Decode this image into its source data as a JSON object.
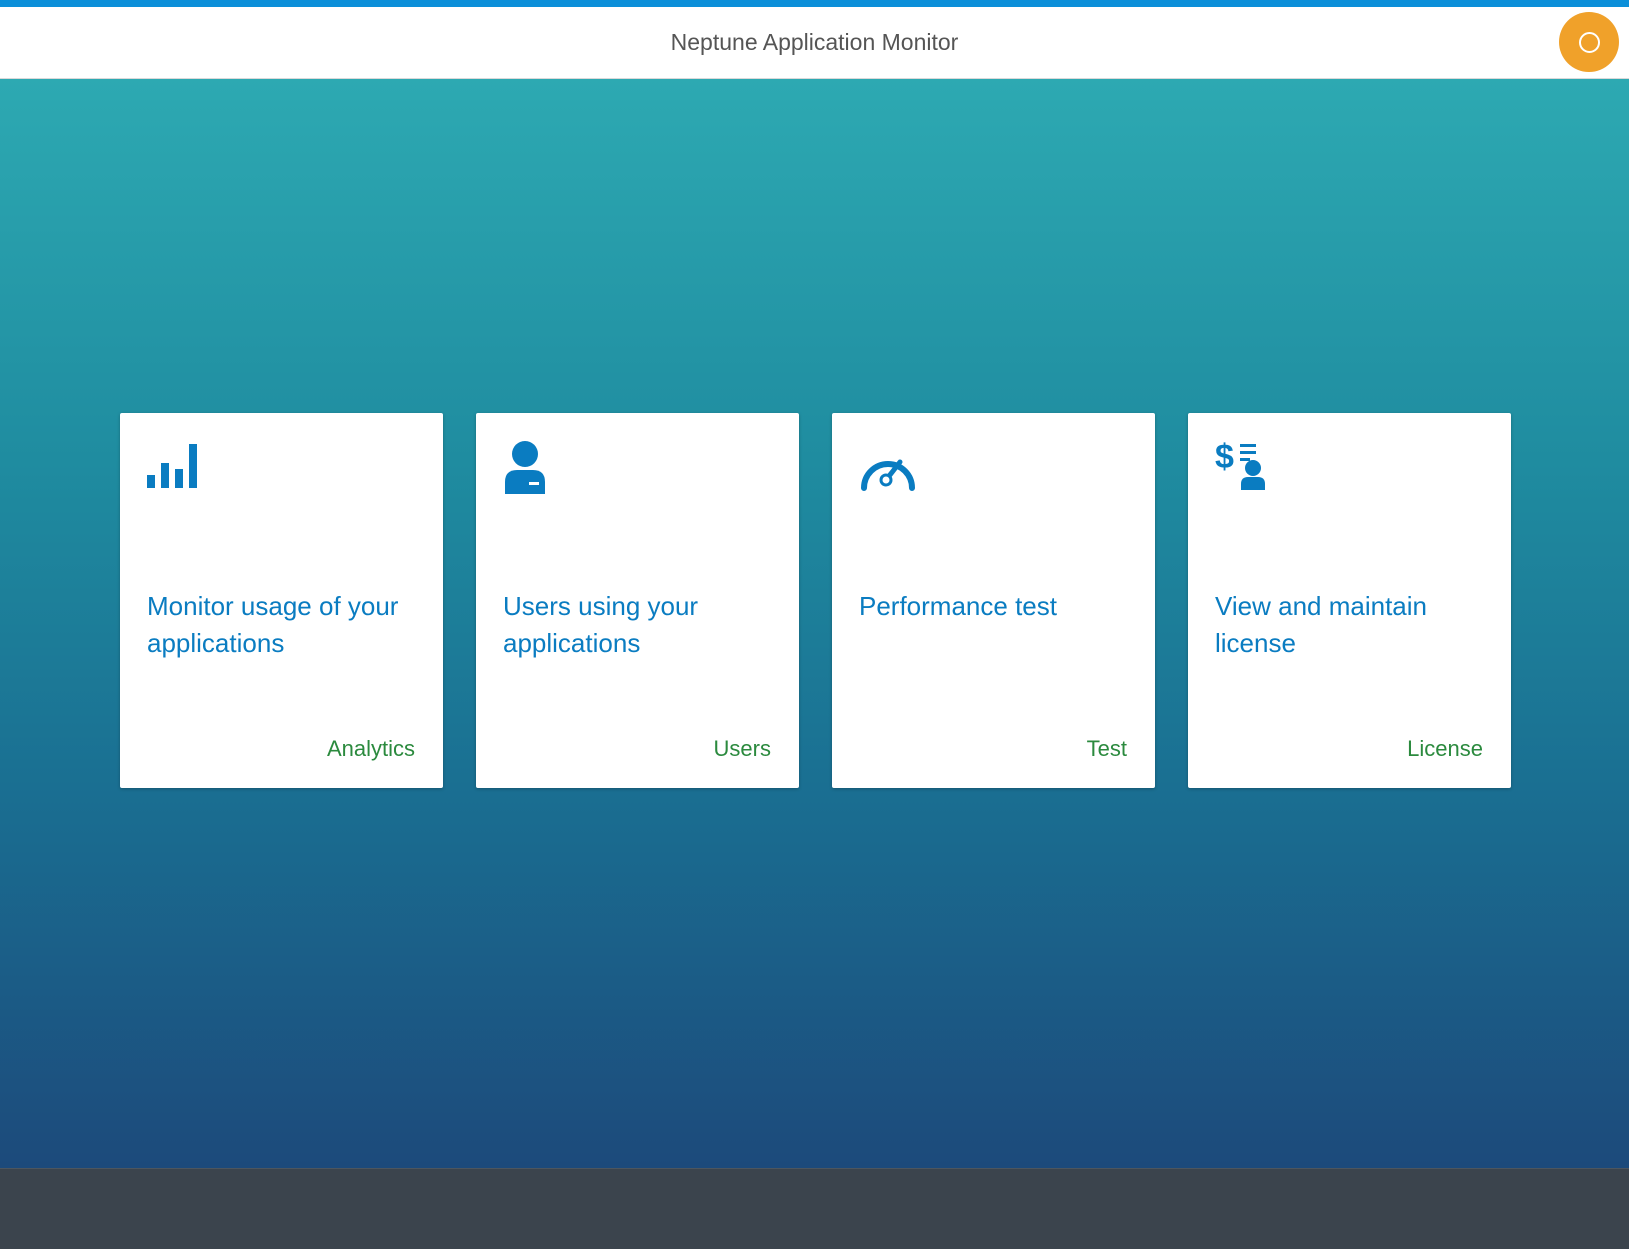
{
  "header": {
    "title": "Neptune Application Monitor",
    "user_icon": "circle-icon",
    "user_color": "#f0a12a"
  },
  "colors": {
    "accent": "#0b8fd9",
    "tile_title": "#0a7cc1",
    "tile_footer": "#2b8a3e",
    "footer_bar": "#3b444d"
  },
  "tiles": [
    {
      "icon": "bar-chart-icon",
      "title": "Monitor usage of your applications",
      "footer": "Analytics"
    },
    {
      "icon": "user-icon",
      "title": "Users using your applications",
      "footer": "Users"
    },
    {
      "icon": "speedometer-icon",
      "title": "Performance test",
      "footer": "Test"
    },
    {
      "icon": "license-icon",
      "title": "View and maintain license",
      "footer": "License"
    }
  ]
}
